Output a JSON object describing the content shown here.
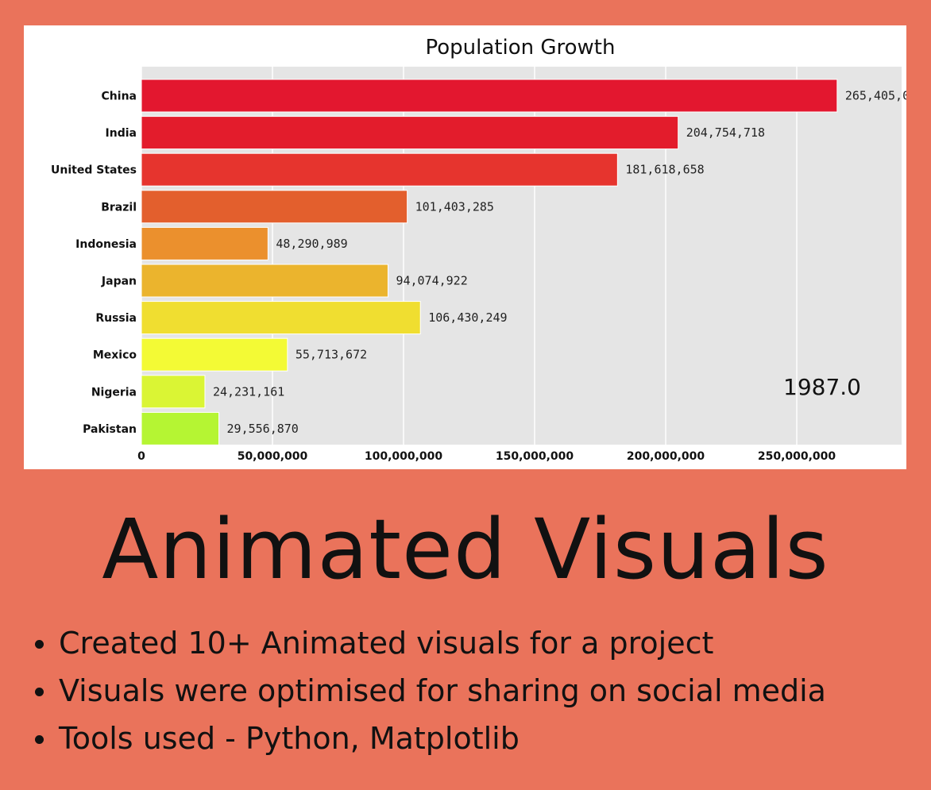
{
  "colors": {
    "background": "#ea735b",
    "panel": "#ffffff",
    "plot_area": "#e5e5e5",
    "text": "#111111"
  },
  "chart_data": {
    "type": "bar",
    "orientation": "horizontal",
    "title": "Population Growth",
    "xlabel": "",
    "ylabel": "",
    "year_label": "1987.0",
    "categories": [
      "China",
      "India",
      "United States",
      "Brazil",
      "Indonesia",
      "Japan",
      "Russia",
      "Mexico",
      "Nigeria",
      "Pakistan"
    ],
    "values": [
      265405000,
      204754718,
      181618658,
      101403285,
      48290989,
      94074922,
      106430249,
      55713672,
      24231161,
      29556870
    ],
    "value_labels": [
      "265,405,0",
      "204,754,718",
      "181,618,658",
      "101,403,285",
      "48,290,989",
      "94,074,922",
      "106,430,249",
      "55,713,672",
      "24,231,161",
      "29,556,870"
    ],
    "bar_colors": [
      "#e3172f",
      "#e31c2c",
      "#e6342e",
      "#e35f2d",
      "#eb902d",
      "#ebb42d",
      "#f0de30",
      "#f3fa35",
      "#daf534",
      "#b5f533"
    ],
    "xlim": [
      0,
      290000000
    ],
    "xticks": [
      0,
      50000000,
      100000000,
      150000000,
      200000000,
      250000000
    ],
    "xtick_labels": [
      "0",
      "50,000,000",
      "100,000,000",
      "150,000,000",
      "200,000,000",
      "250,000,000"
    ],
    "grid": true
  },
  "headline": "Animated Visuals",
  "bullets": [
    "Created 10+ Animated visuals for a project",
    "Visuals were optimised for sharing on social media",
    "Tools used - Python, Matplotlib"
  ]
}
